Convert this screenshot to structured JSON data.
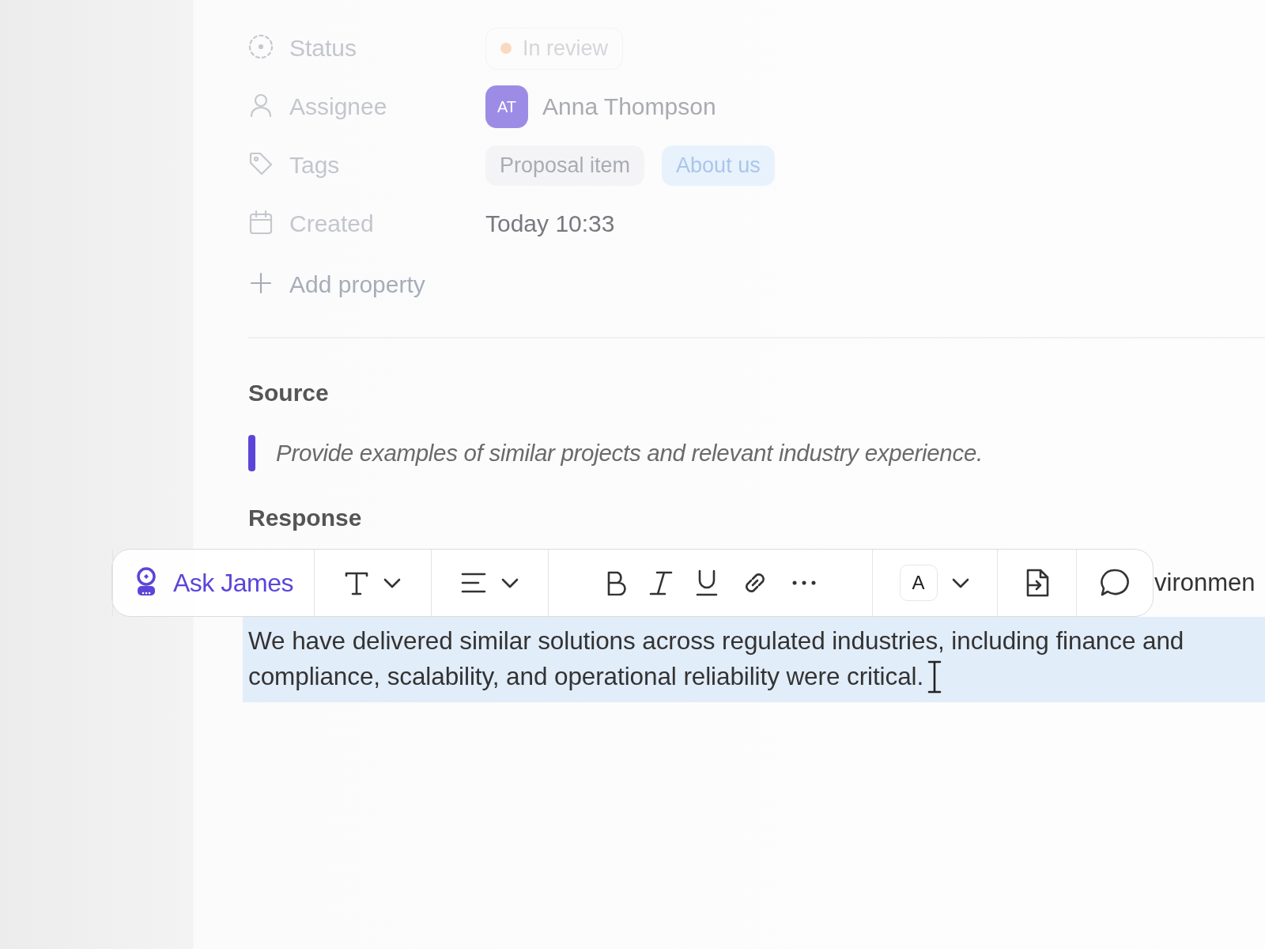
{
  "properties": [
    {
      "kind": "status",
      "label": "Status",
      "value": "In review"
    },
    {
      "kind": "assignee",
      "label": "Assignee",
      "initials": "AT",
      "value": "Anna Thompson"
    },
    {
      "kind": "tags",
      "label": "Tags",
      "tags": [
        {
          "text": "Proposal item",
          "color": "#f4f4f6"
        },
        {
          "text": "About us",
          "color": "#e8f2fd"
        }
      ]
    },
    {
      "kind": "date",
      "label": "Created",
      "value": "Today 10:33"
    }
  ],
  "add_property": "Add property",
  "source": {
    "heading": "Source",
    "quote": "Provide examples of similar projects and relevant industry experience."
  },
  "response": {
    "heading": "Response",
    "line_end": "vironmen",
    "selected": true,
    "lines": [
      "We have delivered similar solutions across regulated industries, including finance and",
      "compliance, scalability, and operational reliability were critical."
    ]
  },
  "toolbar": {
    "groups": [
      [
        {
          "kind": "ask",
          "label": "Ask James"
        }
      ],
      [
        {
          "kind": "text-style"
        },
        {
          "kind": "caret"
        }
      ],
      [
        {
          "kind": "align"
        },
        {
          "kind": "caret"
        }
      ],
      [
        {
          "kind": "bold"
        },
        {
          "kind": "italic"
        },
        {
          "kind": "underline"
        },
        {
          "kind": "link"
        },
        {
          "kind": "more"
        }
      ],
      [
        {
          "kind": "color",
          "label": "A"
        },
        {
          "kind": "caret"
        }
      ],
      [
        {
          "kind": "insert"
        }
      ],
      [
        {
          "kind": "comment"
        }
      ]
    ]
  }
}
